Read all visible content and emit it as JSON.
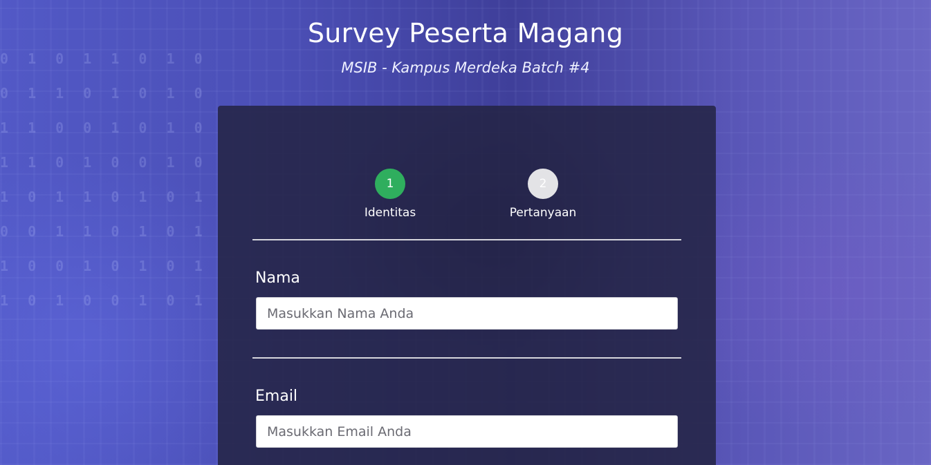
{
  "header": {
    "title": "Survey Peserta Magang",
    "subtitle": "MSIB - Kampus Merdeka Batch #4"
  },
  "steps": [
    {
      "number": "1",
      "label": "Identitas",
      "state": "active",
      "color": "#2fae5e"
    },
    {
      "number": "2",
      "label": "Pertanyaan",
      "state": "inactive",
      "color": "#e3e3e6"
    }
  ],
  "form": {
    "nama": {
      "label": "Nama",
      "placeholder": "Masukkan Nama Anda",
      "value": ""
    },
    "email": {
      "label": "Email",
      "placeholder": "Masukkan Email Anda",
      "value": ""
    }
  },
  "colors": {
    "card_background": "#242446",
    "accent_active": "#2fae5e",
    "page_background": "#4a4fb0"
  }
}
